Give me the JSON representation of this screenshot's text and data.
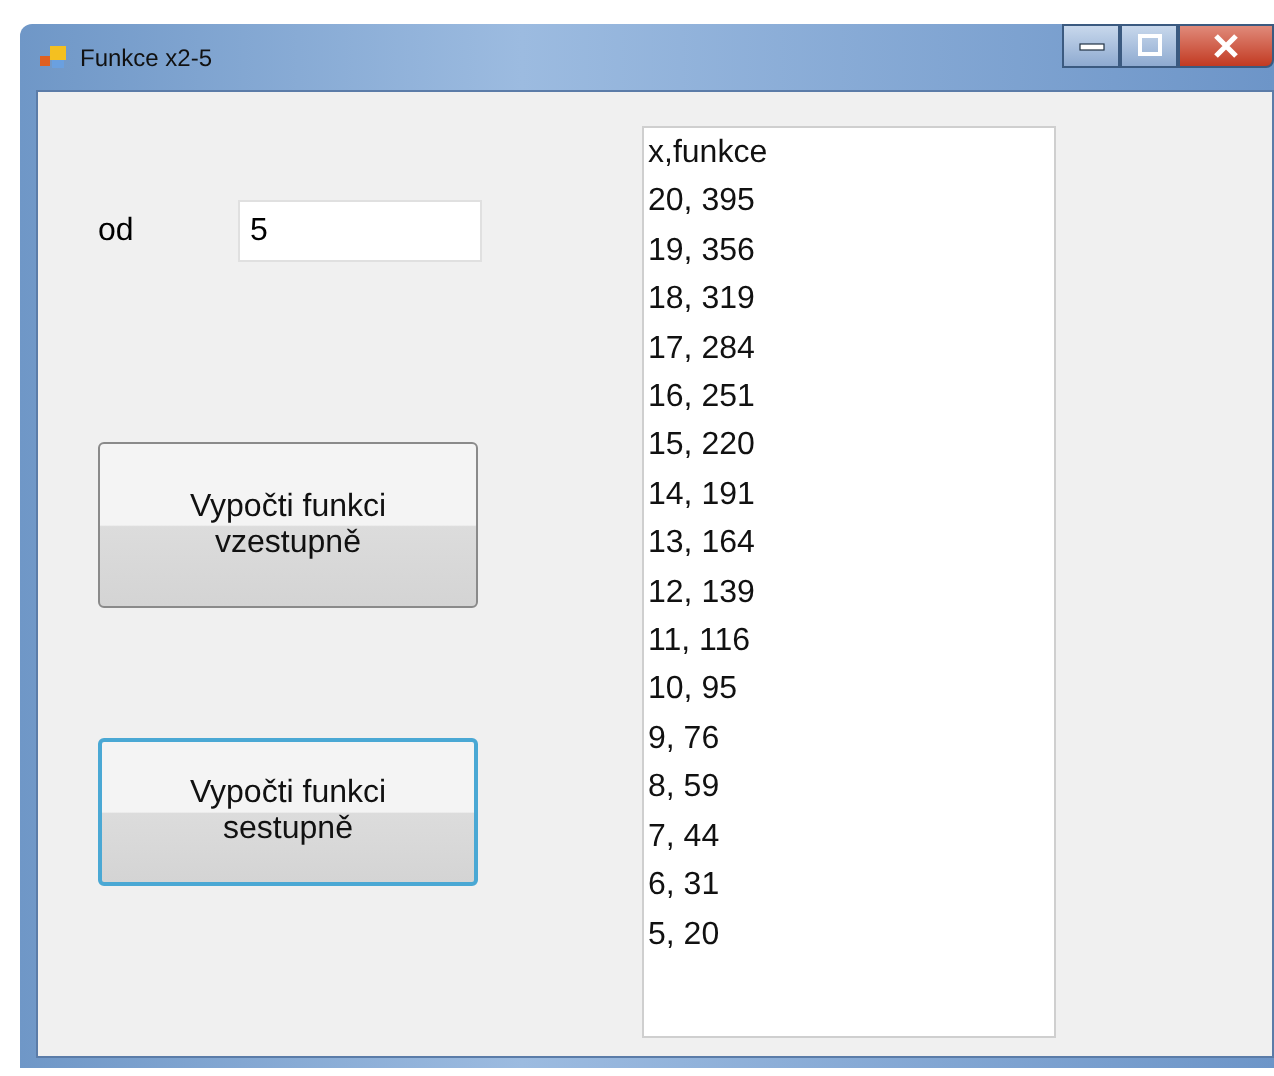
{
  "window": {
    "title": "Funkce x2-5"
  },
  "input": {
    "label": "od",
    "value": "5"
  },
  "buttons": [
    {
      "label": "Vypočti funkci vzestupně",
      "focused": false
    },
    {
      "label": "Vypočti funkci sestupně",
      "focused": true
    }
  ],
  "listbox": {
    "items": [
      "x,funkce",
      "20, 395",
      "19, 356",
      "18, 319",
      "17, 284",
      "16, 251",
      "15, 220",
      "14, 191",
      "13, 164",
      "12, 139",
      "11, 116",
      "10, 95",
      "9, 76",
      "8, 59",
      "7, 44",
      "6, 31",
      "5, 20"
    ]
  }
}
